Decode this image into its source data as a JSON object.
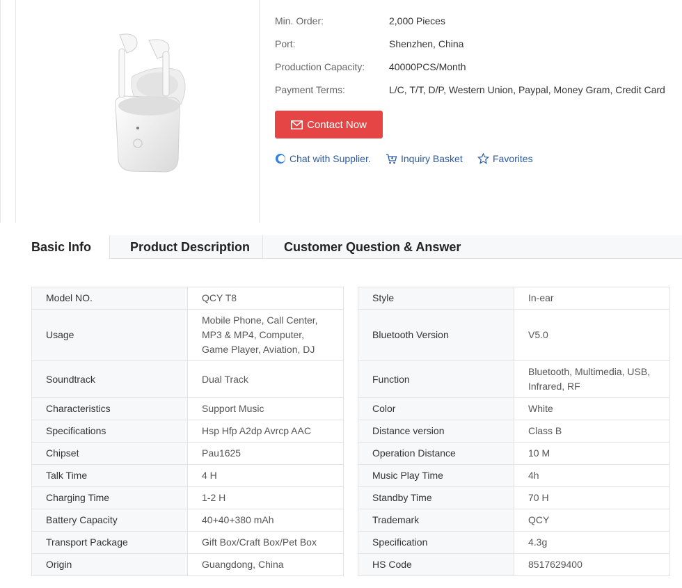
{
  "product": {
    "specs": [
      {
        "label": "Min. Order:",
        "value": "2,000 Pieces"
      },
      {
        "label": "Port:",
        "value": "Shenzhen, China"
      },
      {
        "label": "Production Capacity:",
        "value": "40000PCS/Month"
      },
      {
        "label": "Payment Terms:",
        "value": "L/C, T/T, D/P, Western Union, Paypal, Money Gram, Credit Card"
      }
    ],
    "contact_label": "Contact Now",
    "actions": {
      "chat": "Chat with Supplier.",
      "basket": "Inquiry Basket",
      "favorites": "Favorites"
    },
    "colors": {
      "accent": "#e64545",
      "link": "#2d5aa0"
    }
  },
  "tabs": [
    {
      "label": "Basic Info",
      "active": true
    },
    {
      "label": "Product Description",
      "active": false
    },
    {
      "label": "Customer Question & Answer",
      "active": false
    }
  ],
  "basic_info": {
    "left": [
      {
        "key": "Model NO.",
        "value": "QCY T8"
      },
      {
        "key": "Usage",
        "value": "Mobile Phone, Call Center, MP3 & MP4, Computer, Game Player, Aviation, DJ"
      },
      {
        "key": "Soundtrack",
        "value": "Dual Track"
      },
      {
        "key": "Characteristics",
        "value": "Support Music"
      },
      {
        "key": "Specifications",
        "value": "Hsp Hfp A2dp Avrcp AAC"
      },
      {
        "key": "Chipset",
        "value": "Pau1625"
      },
      {
        "key": "Talk Time",
        "value": "4 H"
      },
      {
        "key": "Charging Time",
        "value": "1-2 H"
      },
      {
        "key": "Battery Capacity",
        "value": "40+40+380 mAh"
      },
      {
        "key": "Transport Package",
        "value": "Gift Box/Craft Box/Pet Box"
      },
      {
        "key": "Origin",
        "value": "Guangdong, China"
      }
    ],
    "right": [
      {
        "key": "Style",
        "value": "In-ear"
      },
      {
        "key": "Bluetooth Version",
        "value": "V5.0"
      },
      {
        "key": "Function",
        "value": "Bluetooth, Multimedia, USB, Infrared, RF"
      },
      {
        "key": "Color",
        "value": "White"
      },
      {
        "key": "Distance version",
        "value": "Class B"
      },
      {
        "key": "Operation Distance",
        "value": "10 M"
      },
      {
        "key": "Music Play Time",
        "value": "4h"
      },
      {
        "key": "Standby Time",
        "value": "70 H"
      },
      {
        "key": "Trademark",
        "value": "QCY"
      },
      {
        "key": "Specification",
        "value": "4.3g"
      },
      {
        "key": "HS Code",
        "value": "8517629400"
      }
    ]
  }
}
